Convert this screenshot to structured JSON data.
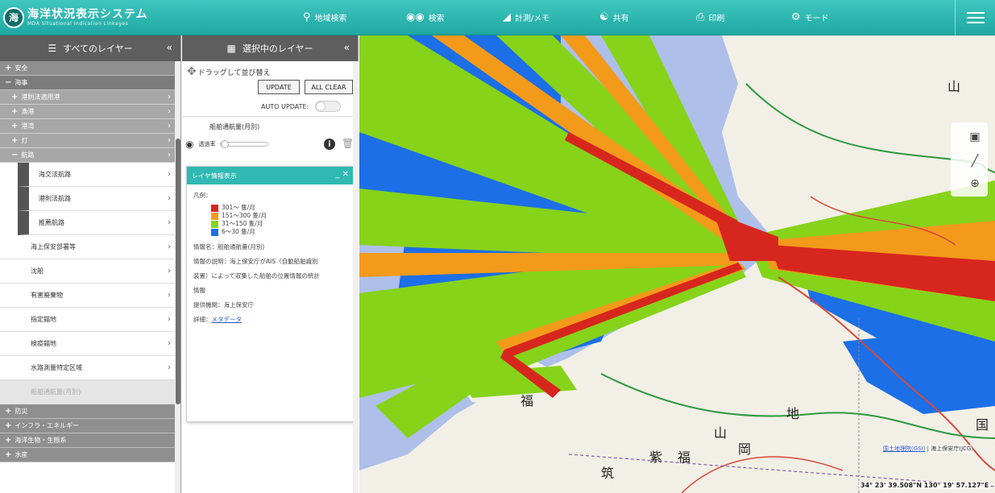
{
  "header": {
    "app_title": "海洋状況表示システム",
    "app_subtitle": "MDA Situational Indication Linkages",
    "logo_text": "海",
    "tools": [
      {
        "label": "地域検索",
        "icon": "magnifier-icon"
      },
      {
        "label": "検索",
        "icon": "binoculars-icon"
      },
      {
        "label": "計測/メモ",
        "icon": "ruler-icon"
      },
      {
        "label": "共有",
        "icon": "share-icon"
      },
      {
        "label": "印刷",
        "icon": "printer-icon"
      },
      {
        "label": "モード",
        "icon": "mode-icon"
      }
    ]
  },
  "all_layers": {
    "title": "すべてのレイヤー",
    "collapse": "«",
    "categories": [
      {
        "label": "安全",
        "sign": "+"
      },
      {
        "label": "海事",
        "sign": "−"
      }
    ],
    "subgroups": [
      {
        "label": "港則法適用港",
        "sign": "+"
      },
      {
        "label": "漁港",
        "sign": "+"
      },
      {
        "label": "港湾",
        "sign": "+"
      },
      {
        "label": "灯",
        "sign": "+"
      },
      {
        "label": "航路",
        "sign": "−"
      }
    ],
    "route_items": [
      {
        "label": "海交法航路"
      },
      {
        "label": "港則法航路"
      },
      {
        "label": "推薦航路"
      }
    ],
    "other_items": [
      {
        "label": "海上保安部署等"
      },
      {
        "label": "沈船"
      },
      {
        "label": "有害廃棄物"
      },
      {
        "label": "指定錨地"
      },
      {
        "label": "検疫錨地"
      },
      {
        "label": "水路測量特定区域"
      },
      {
        "label": "船舶通航量(月別)"
      }
    ],
    "bottom_categories": [
      {
        "label": "防災",
        "sign": "+"
      },
      {
        "label": "インフラ・エネルギー",
        "sign": "+"
      },
      {
        "label": "海洋生物・生態系",
        "sign": "+"
      },
      {
        "label": "水産",
        "sign": "+"
      }
    ]
  },
  "selected_layers": {
    "title": "選択中のレイヤー",
    "collapse": "«",
    "drag_hint": "ドラッグして並び替え",
    "update_btn": "UPDATE",
    "clear_btn": "ALL CLEAR",
    "auto_update": "AUTO UPDATE:",
    "layer_name": "船舶通航量(月別)",
    "opacity_label": "透過率",
    "opacity_value": 0
  },
  "info_panel": {
    "title": "レイヤ情報表示",
    "legend_title": "凡例：",
    "legend": [
      {
        "label": "301～ 隻/月",
        "color": "#d7261e"
      },
      {
        "label": "151～300 隻/月",
        "color": "#f39a1b"
      },
      {
        "label": "31～150 隻/月",
        "color": "#86d31a"
      },
      {
        "label": "6～30 隻/月",
        "color": "#1c6fe6"
      }
    ],
    "name_line": "情報名：船舶通航量(月別)",
    "desc_line1": "情報の説明：海上保安庁がAIS（自動船舶識別",
    "desc_line2": "装置）によって収集した船舶の位置情報の統計",
    "desc_line3": "情報",
    "provider_line": "提供機関：海上保安庁",
    "detail_label": "詳細：",
    "detail_link": "メタデータ"
  },
  "map": {
    "attribution_link": "国土地理院(GSI)",
    "attribution_rest": " | 海上保安庁(JCG)",
    "coordinates": "34° 23' 39.508\"N 130° 19' 57.127\"E",
    "labels": [
      "山",
      "山",
      "岡",
      "福",
      "地",
      "国",
      "紫",
      "筑",
      "福"
    ]
  },
  "colors": {
    "header": "#25b0aa",
    "panel_head": "#5e5e5e",
    "traffic_high": "#d7261e",
    "traffic_mid_high": "#f39a1b",
    "traffic_mid": "#86d31a",
    "traffic_low": "#1c6fe6",
    "sea": "#aebfea",
    "land": "#f2efe6"
  }
}
